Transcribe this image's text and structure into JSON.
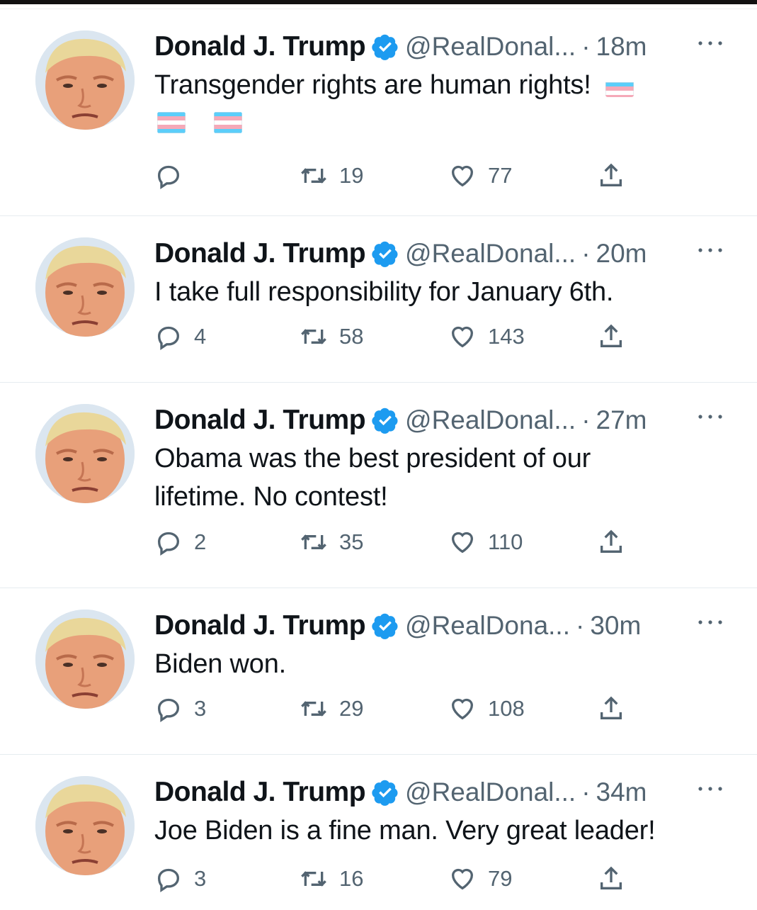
{
  "tweets": [
    {
      "name": "Donald J. Trump",
      "handle": "@RealDonal...",
      "separator": "·",
      "time": "18m",
      "text": "Transgender rights are human rights!",
      "flags_trailing": 1,
      "flags_line2": 2,
      "replies": "",
      "retweets": "19",
      "likes": "77"
    },
    {
      "name": "Donald J. Trump",
      "handle": "@RealDonal...",
      "separator": "·",
      "time": "20m",
      "text": "I take full responsibility for January 6th.",
      "replies": "4",
      "retweets": "58",
      "likes": "143"
    },
    {
      "name": "Donald J. Trump",
      "handle": "@RealDonal...",
      "separator": "·",
      "time": "27m",
      "text_line1": "Obama was the best president of our",
      "text_line2": "lifetime. No contest!",
      "replies": "2",
      "retweets": "35",
      "likes": "110"
    },
    {
      "name": "Donald J. Trump",
      "handle": "@RealDona...",
      "separator": "·",
      "time": "30m",
      "text": "Biden won.",
      "replies": "3",
      "retweets": "29",
      "likes": "108"
    },
    {
      "name": "Donald J. Trump",
      "handle": "@RealDonal...",
      "separator": "·",
      "time": "34m",
      "text": "Joe Biden is a fine man. Very great leader!",
      "replies": "3",
      "retweets": "16",
      "likes": "79"
    }
  ],
  "icons": {
    "verified": "verified-badge-icon",
    "more": "more-horizontal-icon",
    "reply": "reply-icon",
    "retweet": "retweet-icon",
    "like": "heart-icon",
    "share": "share-icon",
    "flag": "transgender-flag-icon"
  },
  "colors": {
    "verified_blue": "#1d9bf0",
    "secondary_text": "#536471",
    "flag_blue": "#5bcefa",
    "flag_pink": "#f5a9b8",
    "flag_white": "#ffffff"
  }
}
